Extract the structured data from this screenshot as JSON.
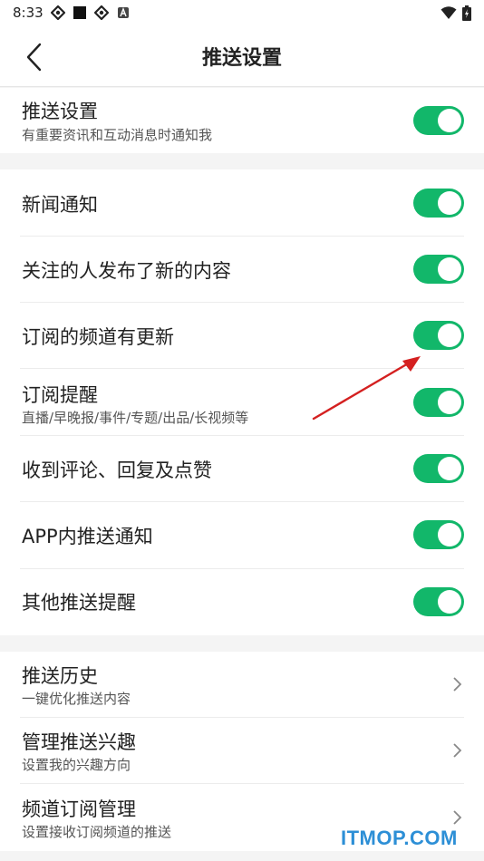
{
  "status_bar": {
    "time": "8:33"
  },
  "header": {
    "title": "推送设置"
  },
  "push_master": {
    "label": "推送设置",
    "sub": "有重要资讯和互动消息时通知我",
    "on": true
  },
  "notifications": [
    {
      "label": "新闻通知",
      "on": true
    },
    {
      "label": "关注的人发布了新的内容",
      "on": true
    },
    {
      "label": "订阅的频道有更新",
      "on": true
    },
    {
      "label": "订阅提醒",
      "sub": "直播/早晚报/事件/专题/出品/长视频等",
      "on": true
    },
    {
      "label": "收到评论、回复及点赞",
      "on": true
    },
    {
      "label": "APP内推送通知",
      "on": true
    },
    {
      "label": "其他推送提醒",
      "on": true
    }
  ],
  "links": [
    {
      "label": "推送历史",
      "sub": "一键优化推送内容"
    },
    {
      "label": "管理推送兴趣",
      "sub": "设置我的兴趣方向"
    },
    {
      "label": "频道订阅管理",
      "sub": "设置接收订阅频道的推送"
    }
  ],
  "colors": {
    "toggle_on": "#12b76a",
    "annotation_arrow": "#d42020",
    "watermark": "#2d8fd6"
  },
  "watermark": "ITMOP.COM"
}
